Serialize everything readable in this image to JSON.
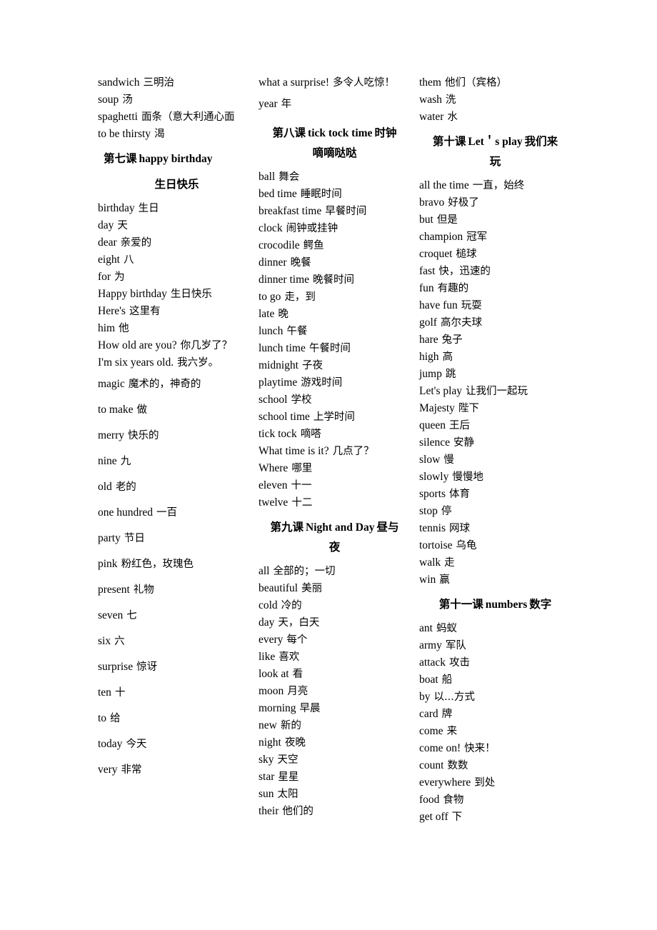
{
  "document": {
    "type": "vocabulary-glossary",
    "language_pair": "English-Chinese"
  },
  "columns": [
    {
      "id": "column-1",
      "blocks": [
        {
          "kind": "entries",
          "spacing": "tight",
          "items": [
            {
              "en": "sandwich",
              "cn": "三明治"
            },
            {
              "en": "soup",
              "cn": "汤"
            },
            {
              "en": "spaghetti",
              "cn": "面条（意大利通心面",
              "wrap": true
            },
            {
              "en": "to be thirsty",
              "cn": "渴"
            }
          ]
        },
        {
          "kind": "lesson",
          "style": "l7",
          "cn_number": "第七课",
          "en_title": "happy birthday",
          "cn_title": "生日快乐"
        },
        {
          "kind": "entries",
          "spacing": "tight",
          "items": [
            {
              "en": "birthday",
              "cn": "生日"
            },
            {
              "en": "day",
              "cn": "天"
            },
            {
              "en": "dear",
              "cn": "亲爱的"
            },
            {
              "en": "eight",
              "cn": "八"
            },
            {
              "en": "for",
              "cn": "为"
            },
            {
              "en": "Happy birthday",
              "cn": "生日快乐"
            },
            {
              "en": "Here's",
              "cn": "这里有"
            },
            {
              "en": "him",
              "cn": "他"
            },
            {
              "en": "How old are you?",
              "cn": "你几岁了？",
              "wrap": true
            },
            {
              "en": "I'm six years old.",
              "cn": "我六岁。"
            }
          ]
        },
        {
          "kind": "entries",
          "spacing": "loose",
          "items": [
            {
              "en": "magic",
              "cn": "魔术的，神奇的"
            },
            {
              "en": "to make",
              "cn": "做"
            },
            {
              "en": "merry",
              "cn": "快乐的"
            },
            {
              "en": "nine",
              "cn": "九"
            },
            {
              "en": "old",
              "cn": "老的"
            },
            {
              "en": "one hundred",
              "cn": "一百"
            },
            {
              "en": "party",
              "cn": "节日"
            },
            {
              "en": "pink",
              "cn": "粉红色，玫瑰色"
            },
            {
              "en": "present",
              "cn": "礼物"
            },
            {
              "en": "seven",
              "cn": "七"
            },
            {
              "en": "six",
              "cn": "六"
            },
            {
              "en": "surprise",
              "cn": "惊讶"
            },
            {
              "en": "ten",
              "cn": "十"
            },
            {
              "en": "to",
              "cn": "给"
            },
            {
              "en": "today",
              "cn": "今天"
            },
            {
              "en": "very",
              "cn": "非常"
            }
          ]
        }
      ]
    },
    {
      "id": "column-2",
      "blocks": [
        {
          "kind": "entries",
          "spacing": "tight",
          "items": [
            {
              "en": "what a surprise!",
              "cn": "多令人吃惊！",
              "wrap": true
            }
          ]
        },
        {
          "kind": "entries",
          "spacing": "loose",
          "items": [
            {
              "en": "year",
              "cn": "年"
            }
          ]
        },
        {
          "kind": "lesson",
          "style": "centered",
          "cn_number": "第八课",
          "en_title": "tick tock time",
          "cn_title": "时钟嘀嘀哒哒",
          "cn_title_inline": "时钟",
          "cn_title_sub": "嘀嘀哒哒"
        },
        {
          "kind": "entries",
          "spacing": "tight",
          "items": [
            {
              "en": "ball",
              "cn": "舞会"
            },
            {
              "en": "bed time",
              "cn": "睡眠时间"
            },
            {
              "en": "breakfast time",
              "cn": "早餐时间"
            },
            {
              "en": "clock",
              "cn": "闹钟或挂钟"
            },
            {
              "en": "crocodile",
              "cn": "鳄鱼"
            },
            {
              "en": "dinner",
              "cn": "晚餐"
            },
            {
              "en": "dinner time",
              "cn": "晚餐时间"
            },
            {
              "en": "to go",
              "cn": "走，到"
            },
            {
              "en": "late",
              "cn": "晚"
            },
            {
              "en": "lunch",
              "cn": "午餐"
            },
            {
              "en": "lunch time",
              "cn": "午餐时间"
            },
            {
              "en": "midnight",
              "cn": "子夜"
            },
            {
              "en": "playtime",
              "cn": "游戏时间"
            },
            {
              "en": "school",
              "cn": "学校"
            },
            {
              "en": "school time",
              "cn": "上学时间"
            },
            {
              "en": "tick tock",
              "cn": "嘀嗒"
            },
            {
              "en": "What time is it?",
              "cn": "几点了？"
            },
            {
              "en": "Where",
              "cn": "哪里"
            },
            {
              "en": "eleven",
              "cn": "十一"
            },
            {
              "en": "twelve",
              "cn": "十二"
            }
          ]
        },
        {
          "kind": "lesson",
          "style": "centered",
          "cn_number": "第九课",
          "en_title": "Night and Day",
          "cn_title": "昼与夜",
          "cn_title_inline": "昼与",
          "cn_title_sub": "夜"
        },
        {
          "kind": "entries",
          "spacing": "tight",
          "items": [
            {
              "en": "all",
              "cn": "全部的；一切"
            },
            {
              "en": "beautiful",
              "cn": "美丽"
            },
            {
              "en": "cold",
              "cn": "冷的"
            },
            {
              "en": "day",
              "cn": "天，白天"
            },
            {
              "en": "every",
              "cn": "每个"
            },
            {
              "en": "like",
              "cn": "喜欢"
            },
            {
              "en": "look at",
              "cn": "看"
            },
            {
              "en": "moon",
              "cn": "月亮"
            },
            {
              "en": "morning",
              "cn": "早晨"
            },
            {
              "en": "new",
              "cn": "新的"
            },
            {
              "en": "night",
              "cn": "夜晚"
            },
            {
              "en": "sky",
              "cn": "天空"
            },
            {
              "en": "star",
              "cn": "星星"
            },
            {
              "en": "sun",
              "cn": "太阳"
            },
            {
              "en": "their",
              "cn": "他们的"
            }
          ]
        }
      ]
    },
    {
      "id": "column-3",
      "blocks": [
        {
          "kind": "entries",
          "spacing": "tight",
          "items": [
            {
              "en": "them",
              "cn": "他们（宾格）"
            },
            {
              "en": "wash",
              "cn": "洗"
            },
            {
              "en": "water",
              "cn": "水"
            }
          ]
        },
        {
          "kind": "lesson",
          "style": "centered",
          "cn_number": "第十课",
          "en_title": "Let's play",
          "en_title_display": "Let＇s play",
          "cn_title": "我们来玩",
          "cn_title_inline": "我们来",
          "cn_title_sub": "玩"
        },
        {
          "kind": "entries",
          "spacing": "tight",
          "items": [
            {
              "en": "all the time",
              "cn": "一直，始终"
            },
            {
              "en": "bravo",
              "cn": "好极了"
            },
            {
              "en": "but",
              "cn": "但是"
            },
            {
              "en": "champion",
              "cn": "冠军"
            },
            {
              "en": "croquet",
              "cn": "槌球"
            },
            {
              "en": "fast",
              "cn": "快，迅速的"
            },
            {
              "en": "fun",
              "cn": "有趣的"
            },
            {
              "en": "have fun",
              "cn": "玩耍"
            },
            {
              "en": "golf",
              "cn": "高尔夫球"
            },
            {
              "en": "hare",
              "cn": "兔子"
            },
            {
              "en": "high",
              "cn": "高"
            },
            {
              "en": "jump",
              "cn": "跳"
            },
            {
              "en": "Let's play",
              "cn": "让我们一起玩"
            },
            {
              "en": "Majesty",
              "cn": "陛下"
            },
            {
              "en": "queen",
              "cn": "王后"
            },
            {
              "en": "silence",
              "cn": "安静"
            },
            {
              "en": "slow",
              "cn": "慢"
            },
            {
              "en": "slowly",
              "cn": "慢慢地"
            },
            {
              "en": "sports",
              "cn": "体育"
            },
            {
              "en": "stop",
              "cn": "停"
            },
            {
              "en": "tennis",
              "cn": "网球"
            },
            {
              "en": "tortoise",
              "cn": "乌龟"
            },
            {
              "en": "walk",
              "cn": "走"
            },
            {
              "en": "win",
              "cn": "赢"
            }
          ]
        },
        {
          "kind": "lesson",
          "style": "single-line",
          "cn_number": "第十一课",
          "en_title": "numbers",
          "cn_title": "数字"
        },
        {
          "kind": "entries",
          "spacing": "tight",
          "items": [
            {
              "en": "ant",
              "cn": "蚂蚁"
            },
            {
              "en": "army",
              "cn": "军队"
            },
            {
              "en": "attack",
              "cn": "攻击"
            },
            {
              "en": "boat",
              "cn": "船"
            },
            {
              "en": "by",
              "cn": "以...方式"
            },
            {
              "en": "card",
              "cn": "牌"
            },
            {
              "en": "come",
              "cn": "来"
            },
            {
              "en": "come on!",
              "cn": "快来！"
            },
            {
              "en": "count",
              "cn": "数数"
            },
            {
              "en": "everywhere",
              "cn": "到处"
            },
            {
              "en": "food",
              "cn": "食物"
            },
            {
              "en": "get off",
              "cn": "下"
            }
          ]
        }
      ]
    }
  ]
}
